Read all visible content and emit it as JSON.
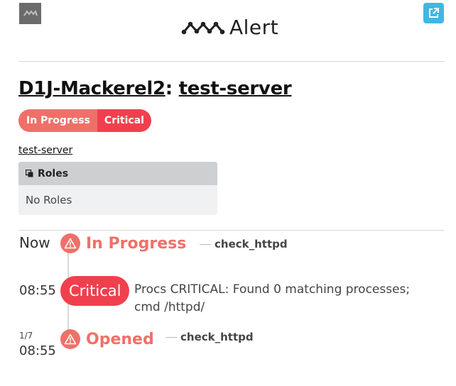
{
  "header": {
    "brand_text": "Alert",
    "left_icon": "mackerel-logo-icon",
    "right_icon": "external-link-icon",
    "right_icon_color": "#41b7e3"
  },
  "alert": {
    "org": "D1J-Mackerel2",
    "separator": ":",
    "host": "test-server",
    "status_badge": "In Progress",
    "level_badge": "Critical",
    "host_link": "test-server"
  },
  "roles": {
    "header": "Roles",
    "empty_text": "No Roles"
  },
  "timeline": {
    "now_label": "Now",
    "now_status": "In Progress",
    "now_monitor": "check_httpd",
    "critical_time": "08:55",
    "critical_label": "Critical",
    "critical_message": "Procs CRITICAL: Found 0 matching processes; cmd /httpd/",
    "opened_date": "1/7",
    "opened_time": "08:55",
    "opened_status": "Opened",
    "opened_monitor": "check_httpd"
  },
  "colors": {
    "in_progress": "#ef7069",
    "critical": "#f0404e",
    "roles_header_bg": "#cdd0d3"
  }
}
